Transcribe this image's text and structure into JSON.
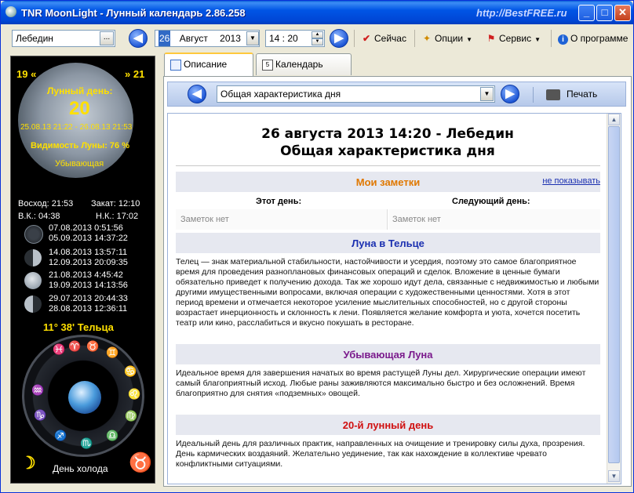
{
  "window": {
    "title": "TNR MoonLight - Лунный календарь 2.86.258",
    "watermark": "http://BestFREE.ru",
    "min_btn": "_",
    "max_btn": "□",
    "close_btn": "✕"
  },
  "toolbar": {
    "city_value": "Лебедин",
    "city_btn": "...",
    "date_day": "26",
    "date_month": "Август",
    "date_year": "2013",
    "time_value": "14 : 20",
    "apply_label": "Сейчас",
    "options_label": "Опции",
    "service_label": "Сервис",
    "about_label": "О программе",
    "back_icon": "◀",
    "forward_icon": "▶",
    "dropdown_icon": "▼"
  },
  "left_panel": {
    "prev_day": "19 «",
    "next_day": "» 21",
    "lunar_day_label": "Лунный день:",
    "lunar_day_number": "20",
    "lunar_day_range": "25.08.13 21:22 - 26.08.13 21:53",
    "visibility": "Видимость Луны: 76 %",
    "phase_name": "Убывающая",
    "sunrise": "Восход: 21:53",
    "sunset": "Закат: 12:10",
    "vk": "В.К.:    04:38",
    "nk": "Н.К.:    17:02",
    "phases": [
      {
        "d1": "07.08.2013 0:51:56",
        "d2": "05.09.2013 14:37:22"
      },
      {
        "d1": "14.08.2013 13:57:11",
        "d2": "12.09.2013 20:09:35"
      },
      {
        "d1": "21.08.2013 4:45:42",
        "d2": "19.09.2013 14:13:56"
      },
      {
        "d1": "29.07.2013 20:44:33",
        "d2": "28.08.2013 12:36:11"
      }
    ],
    "zodiac_position": "11° 38' Тельца",
    "zodiac_signs": [
      "♓",
      "♈",
      "♉",
      "♊",
      "♋",
      "♌",
      "♍",
      "♎",
      "♏",
      "♐",
      "♑",
      "♒"
    ],
    "day_label": "День холода",
    "moon_sign_icon": "☽",
    "taurus_icon": "♉"
  },
  "tabs": [
    {
      "label": "Описание",
      "active": true
    },
    {
      "label": "Календарь",
      "active": false
    }
  ],
  "subbar": {
    "section_select": "Общая характеристика дня",
    "print_label": "Печать"
  },
  "doc": {
    "heading_line1": "26 августа 2013 14:20 - Лебедин",
    "heading_line2": "Общая характеристика дня",
    "notes_title": "Мои заметки",
    "notes_hide": "не показывать",
    "this_day": "Этот день:",
    "next_day": "Следующий день:",
    "no_notes_1": "Заметок нет",
    "no_notes_2": "Заметок нет",
    "sections": [
      {
        "title": "Луна в Тельце",
        "color": "#1a2fb0",
        "text": "Телец — знак материальной стабильности, настойчивости и усердия, поэтому это самое благоприятное время для проведения разноплановых финансовых операций и сделок. Вложение в ценные бумаги обязательно приведет к получению дохода. Так же хорошо идут дела, связанные с недвижимостью и любыми другими имущественными вопросами, включая операции с художественными ценностями. Хотя в этот период времени и отмечается некоторое усиление мыслительных способностей, но с другой стороны возрастает инерционность и склонность к лени. Появляется желание комфорта и уюта, хочется посетить театр или кино, расслабиться и вкусно покушать в ресторане."
      },
      {
        "title": "Убывающая Луна",
        "color": "#7a1a8c",
        "text": "Идеальное время для завершения начатых во время растущей Луны дел. Хирургические операции имеют самый благоприятный исход. Любые раны заживляются максимально быстро и без осложнений. Время благоприятно для снятия «подземных» овощей."
      },
      {
        "title": "20-й лунный день",
        "color": "#d01010",
        "text": "Идеальный день для различных практик, направленных на очищение и тренировку силы духа, прозрения. День кармических воздаяний. Желательно уединение, так как нахождение в коллективе чревато конфликтными ситуациями."
      }
    ]
  }
}
